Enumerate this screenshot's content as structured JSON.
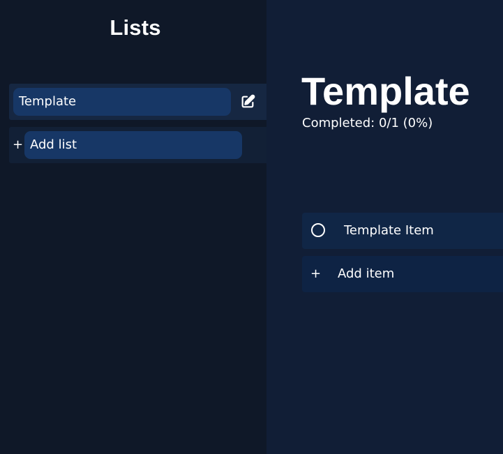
{
  "sidebar": {
    "title": "Lists",
    "lists": [
      {
        "label": "Template",
        "action_icon": "edit-icon"
      }
    ],
    "add_list": {
      "icon": "plus-icon",
      "label": "Add list"
    }
  },
  "main": {
    "title": "Template",
    "completed_text": "Completed: 0/1 (0%)",
    "completed_count": 0,
    "total_count": 1,
    "completed_percent": 0,
    "items": [
      {
        "label": "Template Item",
        "checked": false,
        "icon": "circle-checkbox-icon"
      }
    ],
    "add_item": {
      "icon": "plus-icon",
      "label": "Add item"
    }
  },
  "colors": {
    "sidebar_bg": "#0f1828",
    "main_bg": "#111e36",
    "row_bg": "#162742",
    "pill_bg": "#173766",
    "item_bg": "#102646",
    "text": "#ffffff"
  }
}
